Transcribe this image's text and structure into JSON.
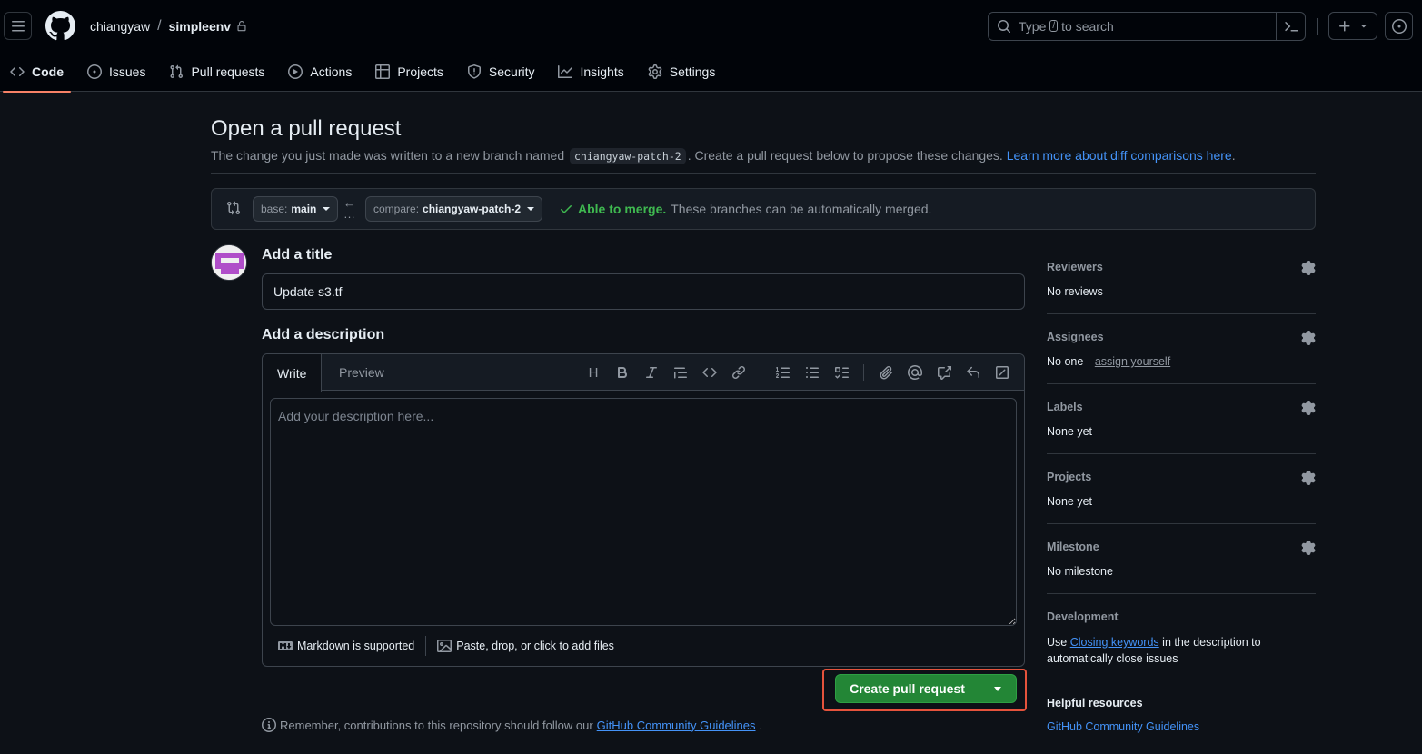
{
  "header": {
    "owner": "chiangyaw",
    "separator": "/",
    "repo": "simpleenv",
    "search": {
      "before": "Type",
      "key": "/",
      "after": "to search"
    }
  },
  "tabs": [
    {
      "label": "Code",
      "icon": "code-icon",
      "active": true
    },
    {
      "label": "Issues",
      "icon": "issue-opened-icon"
    },
    {
      "label": "Pull requests",
      "icon": "git-pull-request-icon"
    },
    {
      "label": "Actions",
      "icon": "play-icon"
    },
    {
      "label": "Projects",
      "icon": "table-icon"
    },
    {
      "label": "Security",
      "icon": "shield-icon"
    },
    {
      "label": "Insights",
      "icon": "graph-icon"
    },
    {
      "label": "Settings",
      "icon": "gear-icon"
    }
  ],
  "main": {
    "title": "Open a pull request",
    "subtitle_before": "The change you just made was written to a new branch named",
    "branch_name": "chiangyaw-patch-2",
    "subtitle_after": ". Create a pull request below to propose these changes.",
    "learn_more": "Learn more about diff comparisons here",
    "learn_more_suffix": "."
  },
  "compare": {
    "base_prefix": "base:",
    "base_branch": "main",
    "compare_prefix": "compare:",
    "compare_branch": "chiangyaw-patch-2",
    "merge_ok": "Able to merge.",
    "merge_desc": "These branches can be automatically merged."
  },
  "form": {
    "title_label": "Add a title",
    "title_value": "Update s3.tf",
    "description_label": "Add a description",
    "tab_write": "Write",
    "tab_preview": "Preview",
    "description_placeholder": "Add your description here...",
    "markdown_note": "Markdown is supported",
    "attach_note": "Paste, drop, or click to add files",
    "toolbar_heading": "H",
    "submit": "Create pull request",
    "remember_text": "Remember, contributions to this repository should follow our",
    "remember_link": "GitHub Community Guidelines",
    "remember_suffix": "."
  },
  "sidebar": {
    "reviewers": {
      "label": "Reviewers",
      "value": "No reviews"
    },
    "assignees": {
      "label": "Assignees",
      "value_prefix": "No one—",
      "value_link": "assign yourself"
    },
    "labels": {
      "label": "Labels",
      "value": "None yet"
    },
    "projects": {
      "label": "Projects",
      "value": "None yet"
    },
    "milestone": {
      "label": "Milestone",
      "value": "No milestone"
    },
    "development": {
      "label": "Development",
      "text_before": "Use",
      "link": "Closing keywords",
      "text_after": "in the description to automatically close issues"
    },
    "help": {
      "label": "Helpful resources",
      "link": "GitHub Community Guidelines"
    }
  },
  "colors": {
    "background": "#0d1117",
    "header_background": "#010409",
    "accent_link": "#4493f8",
    "success": "#3fb950",
    "primary_button": "#238636",
    "active_tab_underline": "#f78166",
    "highlight_box": "#e5533c"
  }
}
